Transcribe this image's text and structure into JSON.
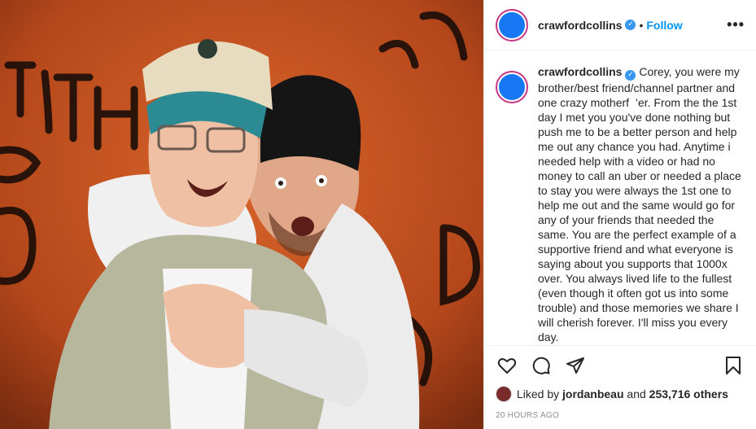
{
  "post": {
    "username": "crawfordcollins",
    "verified_glyph": "✓",
    "follow_label": "Follow",
    "separator": "•",
    "more_label": "•••",
    "avatar_color": "#1877f2",
    "ring_color": "#c93684"
  },
  "caption": {
    "username": "crawfordcollins",
    "text": "Corey, you were my brother/best friend/channel partner and one crazy motherf  ’er. From the the 1st day I met you you've done nothing but push me to be a better person and help me out any chance you had. Anytime i needed help with a video or had no money to call an uber or needed a place to stay you were always the 1st one to help me out and the same would go for any of your friends that needed the same. You are the perfect example of a supportive friend and what everyone is saying about you supports that 1000x over. You always lived life to the fullest (even though it often got us into some trouble) and those memories we share I will cherish forever. I'll miss you every day."
  },
  "actions": {
    "icons": [
      "heart-icon",
      "comment-icon",
      "share-icon",
      "bookmark-icon"
    ],
    "likes_prefix": "Liked by",
    "liked_by_user": "jordanbeau",
    "likes_and": "and",
    "likes_count": "253,716 others",
    "time_ago": "20 HOURS AGO"
  },
  "photo": {
    "graffiti_text": [
      "BIRTH",
      "ORTH",
      "RD"
    ]
  }
}
